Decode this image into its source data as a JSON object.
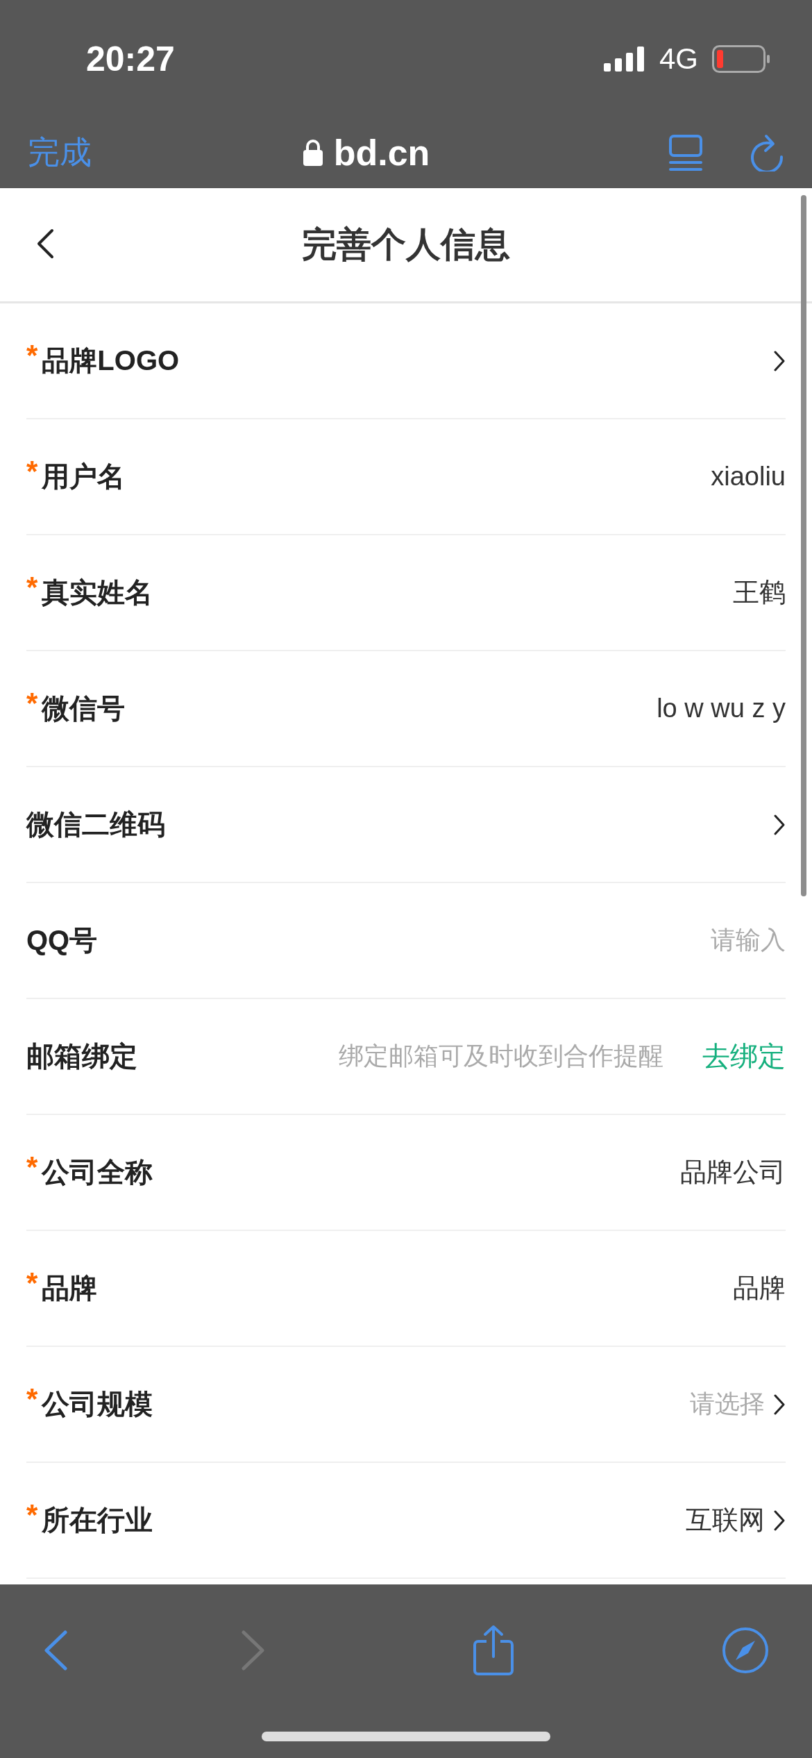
{
  "status_bar": {
    "time": "20:27",
    "network": "4G"
  },
  "browser_bar": {
    "done": "完成",
    "url": "bd.cn"
  },
  "header": {
    "title": "完善个人信息"
  },
  "fields": [
    {
      "mark": "*",
      "label": "品牌LOGO",
      "chevron": true
    },
    {
      "mark": "*",
      "label": "用户名",
      "value": "xiaoliu",
      "chevron": false
    },
    {
      "mark": "*",
      "label": "真实姓名",
      "value": "王鹤",
      "chevron": false
    },
    {
      "mark": "*",
      "label": "微信号",
      "value": "lo w wu z y",
      "chevron": false
    },
    {
      "label": "微信二维码",
      "chevron": true
    },
    {
      "label": "QQ号",
      "placeholder": "请输入",
      "chevron": false
    },
    {
      "label": "邮箱绑定",
      "placeholder": "绑定邮箱可及时收到合作提醒",
      "action": "去绑定",
      "chevron": false
    },
    {
      "mark": "*",
      "label": "公司全称",
      "value": "品牌公司",
      "chevron": false
    },
    {
      "mark": "*",
      "label": "品牌",
      "value": "品牌",
      "chevron": false
    },
    {
      "mark": "*",
      "label": "公司规模",
      "placeholder": "请选择",
      "chevron": true
    },
    {
      "mark": "*",
      "label": "所在行业",
      "value": "互联网",
      "chevron": true
    }
  ]
}
